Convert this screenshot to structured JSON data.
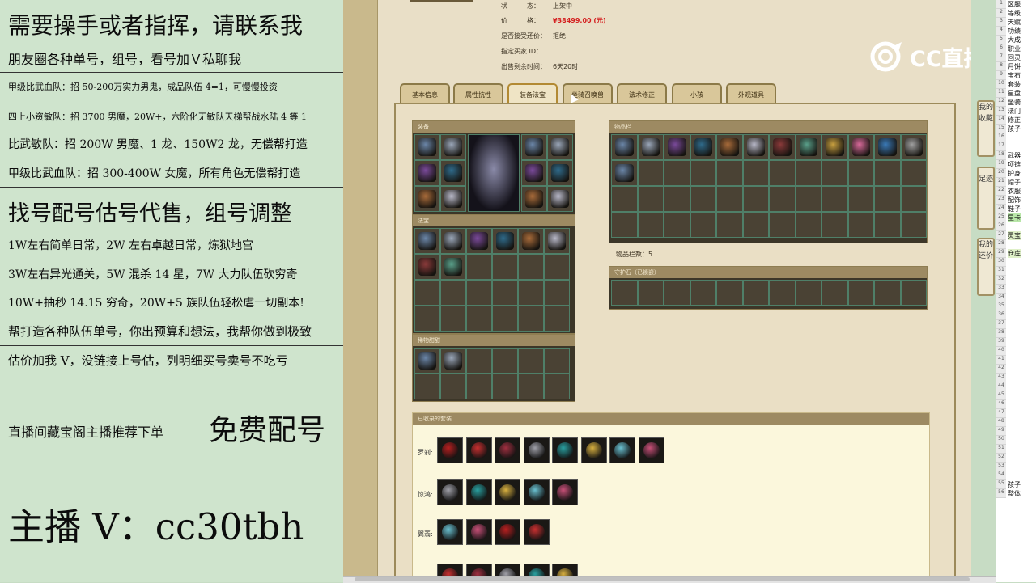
{
  "overlay": {
    "line1": "需要操手或者指挥，请联系我",
    "line2": "朋友圈各种单号，组号，看号加Ｖ私聊我",
    "line3": "甲级比武血队：招 50-200万实力男鬼，成品队伍 4=1，可慢慢投资",
    "line4": "四上小资敏队：招 3700 男魔，20W+，六阶化无敏队天梯帮战水陆 4 等 1",
    "line5": "比武敏队：招 200W 男魔、1 龙、150W2 龙，无偿帮打造",
    "line6": "甲级比武血队：招 300-400W 女魔，所有角色无偿帮打造",
    "line7": "找号配号估号代售，组号调整",
    "line8": "1W左右简单日常，2W 左右卓越日常，炼狱地宫",
    "line9": "3W左右异光通关，5W 混杀 14 星，7W 大力队伍砍穷奇",
    "line10": "10W+抽秒 14.15 穷奇，20W+5 族队伍轻松虐一切副本!",
    "line11": "帮打造各种队伍单号，你出预算和想法，我帮你做到极致",
    "line12": "估价加我 V，没链接上号估，列明细买号卖号不吃亏",
    "line13a": "直播间藏宝阁主播推荐下单",
    "line13b": "免费配号",
    "line14": "主播 V：cc30tbh"
  },
  "info": {
    "status_label": "状　　　态：",
    "status_value": "上架中",
    "price_label": "价　　　格：",
    "price_value": "¥38499.00 (元)",
    "bargain_label": "是否接受还价：",
    "bargain_value": "拒绝",
    "buyer_label": "指定买家 ID：",
    "time_label": "出售剩余时间：",
    "time_value": "6天20时"
  },
  "tabs": [
    "基本信息",
    "属性抗性",
    "装备法宝",
    "坐骑召唤兽",
    "法术修正",
    "小孩",
    "外观道具"
  ],
  "panels": {
    "equip_title": "装备",
    "fabao_title": "法宝",
    "baby_title": "稀物甜甜",
    "bag_title": "物品栏",
    "bag_count_label": "物品栏数：",
    "bag_count_value": "5",
    "guard_title": "守护石（已锁嵌）",
    "collect_title": "已收录的套装",
    "set1_label": "罗刹:",
    "set2_label": "惊鸿:",
    "set3_label": "翼翡:"
  },
  "sidebar": {
    "btn1": "我的收藏",
    "btn2": "足迹",
    "btn3": "我的还价"
  },
  "logo": {
    "text": "CC直播"
  },
  "sheet": {
    "rows": [
      "区服",
      "等级",
      "天赋",
      "功绩",
      "大成",
      "职业",
      "回灵",
      "月饼",
      "宝石",
      "套装",
      "星盘",
      "坐骑",
      "法门",
      "修正",
      "孩子",
      "",
      "",
      "武器",
      "项链",
      "护身",
      "帽子",
      "衣服",
      "配饰",
      "鞋子",
      "星卡",
      "",
      "灵宝",
      "",
      "仓库",
      "",
      "",
      "",
      "",
      "",
      "",
      "",
      "",
      "",
      "",
      "",
      "",
      "",
      "",
      "",
      "",
      "",
      "",
      "",
      "",
      "",
      "",
      "",
      "",
      "",
      "孩子",
      "整体"
    ]
  },
  "colors": {
    "price": "#d42020",
    "overlay_bg": "#cfe4cd",
    "page_bg": "#e9dfc7",
    "slot": "#4a4234"
  }
}
